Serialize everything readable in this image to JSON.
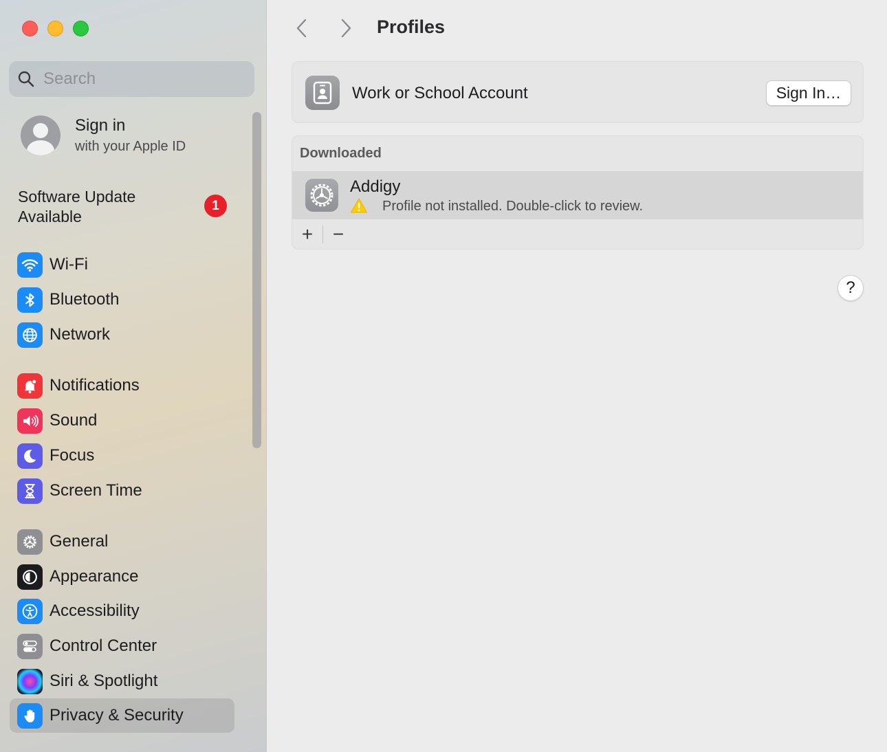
{
  "window": {
    "title": "Profiles"
  },
  "sidebar": {
    "search_placeholder": "Search",
    "signin": {
      "title": "Sign in",
      "subtitle": "with your Apple ID"
    },
    "update": {
      "line1": "Software Update",
      "line2": "Available",
      "badge": "1"
    },
    "items": [
      {
        "label": "Wi-Fi",
        "icon": "wifi-icon",
        "color": "#1b8bf5"
      },
      {
        "label": "Bluetooth",
        "icon": "bluetooth-icon",
        "color": "#1b8bf5"
      },
      {
        "label": "Network",
        "icon": "globe-icon",
        "color": "#1b8bf5"
      },
      {
        "label": "Notifications",
        "icon": "bell-icon",
        "color": "#f0353a"
      },
      {
        "label": "Sound",
        "icon": "speaker-icon",
        "color": "#f0355c"
      },
      {
        "label": "Focus",
        "icon": "moon-icon",
        "color": "#5e5ce6"
      },
      {
        "label": "Screen Time",
        "icon": "hourglass-icon",
        "color": "#5e5ce6"
      },
      {
        "label": "General",
        "icon": "gear-icon",
        "color": "#8e8e93"
      },
      {
        "label": "Appearance",
        "icon": "appearance-icon",
        "color": "#1c1c1e"
      },
      {
        "label": "Accessibility",
        "icon": "accessibility-icon",
        "color": "#1b8bf5"
      },
      {
        "label": "Control Center",
        "icon": "toggles-icon",
        "color": "#8e8e93"
      },
      {
        "label": "Siri & Spotlight",
        "icon": "siri-icon",
        "color": "#2a2a5a"
      },
      {
        "label": "Privacy & Security",
        "icon": "hand-icon",
        "color": "#1b8bf5",
        "selected": true
      }
    ]
  },
  "main": {
    "work_account": {
      "label": "Work or School Account",
      "button": "Sign In…"
    },
    "downloaded": {
      "header": "Downloaded",
      "profile_name": "Addigy",
      "profile_status": "Profile not installed. Double-click to review."
    },
    "tools": {
      "add": "+",
      "remove": "−"
    },
    "help": "?"
  }
}
